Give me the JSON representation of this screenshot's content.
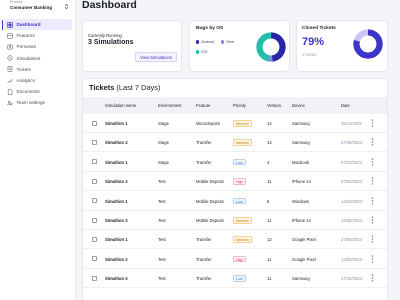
{
  "sidebar": {
    "product_label": "Product",
    "product_name": "Consumer Banking",
    "items": [
      {
        "label": "Dashboard",
        "icon": "dashboard-icon",
        "active": true
      },
      {
        "label": "Features",
        "icon": "features-icon",
        "active": false
      },
      {
        "label": "Personas",
        "icon": "personas-icon",
        "active": false
      },
      {
        "label": "Simulations",
        "icon": "simulations-icon",
        "active": false
      },
      {
        "label": "Tickets",
        "icon": "tickets-icon",
        "active": false
      },
      {
        "label": "Analytics",
        "icon": "analytics-icon",
        "active": false
      },
      {
        "label": "Documents",
        "icon": "documents-icon",
        "active": false
      },
      {
        "label": "Team settings",
        "icon": "team-settings-icon",
        "active": false
      }
    ]
  },
  "header": {
    "title": "Dashboard"
  },
  "cards": {
    "running": {
      "label": "Currently Running",
      "value": "3 Simulations",
      "button": "View Simulations"
    },
    "bugs": {
      "title": "Bugs by OS",
      "legend": [
        {
          "name": "Android",
          "color": "#2a25a8"
        },
        {
          "name": "Web",
          "color": "#8b84e8"
        },
        {
          "name": "iOS",
          "color": "#1fbfa9"
        }
      ],
      "share": {
        "Android": 0.48,
        "Web": 0.04,
        "iOS": 0.48
      }
    },
    "closed": {
      "title": "Closed Tickets",
      "percent": "79%",
      "fraction": "174/220",
      "ratio": 0.79
    }
  },
  "tickets": {
    "title": "Tickets",
    "period": "(Last 7 Days)",
    "columns": [
      "Simulation name",
      "Environment",
      "Feature",
      "Priority",
      "Version",
      "Device",
      "Date"
    ],
    "rows": [
      {
        "name": "Simultion 1",
        "env": "Stage",
        "feature": "Microdeposit",
        "priority": "Medium",
        "version": "14",
        "device": "Samsung",
        "date": "25/11/2025"
      },
      {
        "name": "Simultion 2",
        "env": "Stage",
        "feature": "Transfer",
        "priority": "Medium",
        "version": "14",
        "device": "Samsung",
        "date": "27/09/2024"
      },
      {
        "name": "Simultion 1",
        "env": "Stage",
        "feature": "Transfer",
        "priority": "Low",
        "version": "4",
        "device": "Macbook",
        "date": "07/02/2024"
      },
      {
        "name": "Simultion 3",
        "env": "Test",
        "feature": "Mobile Deposit",
        "priority": "High",
        "version": "11",
        "device": "iPhone 14",
        "date": "07/02/2024"
      },
      {
        "name": "Simultion 1",
        "env": "Test",
        "feature": "Mobile Deposit",
        "priority": "Low",
        "version": "5",
        "device": "Windows",
        "date": "14/03/2024"
      },
      {
        "name": "Simultion 3",
        "env": "Test",
        "feature": "Mobile Deposit",
        "priority": "Medium",
        "version": "11",
        "device": "iPhone 14",
        "date": "13/02/2024"
      },
      {
        "name": "Simultion 1",
        "env": "Test",
        "feature": "Transfer",
        "priority": "Medium",
        "version": "12",
        "device": "Google Pixel",
        "date": "27/09/2024"
      },
      {
        "name": "Simultion 2",
        "env": "Test",
        "feature": "Transfer",
        "priority": "High",
        "version": "11",
        "device": "Google Pixel",
        "date": "13/02/2024"
      },
      {
        "name": "Simultion 3",
        "env": "Test",
        "feature": "Transfer",
        "priority": "Low",
        "version": "11",
        "device": "Samsung",
        "date": "17/10/2024"
      }
    ]
  },
  "priority_colors": {
    "Medium": {
      "fg": "#c07b07",
      "bg": "#fff7e6",
      "border": "#f5d38f"
    },
    "Low": {
      "fg": "#3a7bd5",
      "bg": "#eef5ff",
      "border": "#b9d3f7"
    },
    "High": {
      "fg": "#d6455d",
      "bg": "#fff0f2",
      "border": "#f5b9c3"
    }
  }
}
